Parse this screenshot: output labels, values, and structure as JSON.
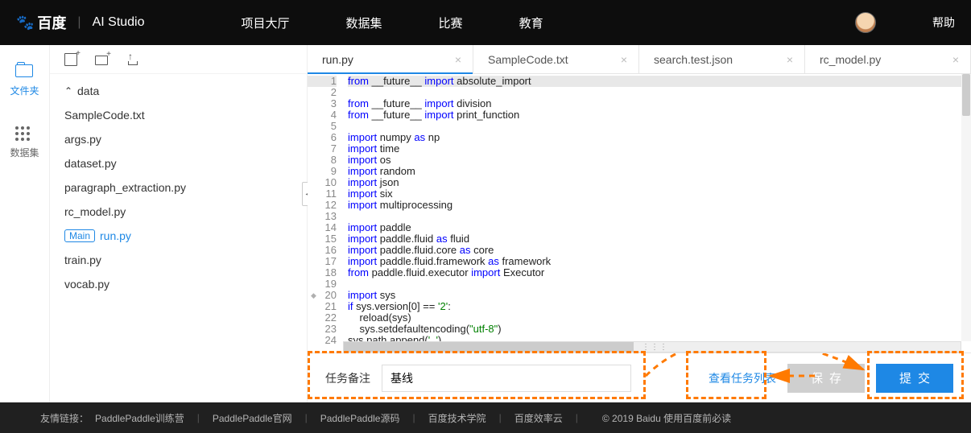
{
  "nav": {
    "logo_brand": "百度",
    "logo_product": "AI Studio",
    "items": [
      "项目大厅",
      "数据集",
      "比赛",
      "教育"
    ],
    "help": "帮助"
  },
  "rail": {
    "files_label": "文件夹",
    "dataset_label": "数据集"
  },
  "tree": {
    "folder": "data",
    "files": [
      "SampleCode.txt",
      "args.py",
      "dataset.py",
      "paragraph_extraction.py",
      "rc_model.py",
      "run.py",
      "train.py",
      "vocab.py"
    ],
    "main_badge": "Main",
    "active": "run.py"
  },
  "tabs": [
    {
      "name": "run.py",
      "active": true
    },
    {
      "name": "SampleCode.txt",
      "active": false
    },
    {
      "name": "search.test.json",
      "active": false
    },
    {
      "name": "rc_model.py",
      "active": false
    }
  ],
  "code": {
    "lines": [
      {
        "n": 1,
        "t": "from __future__ import absolute_import",
        "hl": true
      },
      {
        "n": 2,
        "t": "from __future__ import division"
      },
      {
        "n": 3,
        "t": "from __future__ import print_function"
      },
      {
        "n": 4,
        "t": ""
      },
      {
        "n": 5,
        "t": "import numpy as np"
      },
      {
        "n": 6,
        "t": "import time"
      },
      {
        "n": 7,
        "t": "import os"
      },
      {
        "n": 8,
        "t": "import random"
      },
      {
        "n": 9,
        "t": "import json"
      },
      {
        "n": 10,
        "t": "import six"
      },
      {
        "n": 11,
        "t": "import multiprocessing"
      },
      {
        "n": 12,
        "t": ""
      },
      {
        "n": 13,
        "t": "import paddle"
      },
      {
        "n": 14,
        "t": "import paddle.fluid as fluid"
      },
      {
        "n": 15,
        "t": "import paddle.fluid.core as core"
      },
      {
        "n": 16,
        "t": "import paddle.fluid.framework as framework"
      },
      {
        "n": 17,
        "t": "from paddle.fluid.executor import Executor"
      },
      {
        "n": 18,
        "t": ""
      },
      {
        "n": 19,
        "t": "import sys"
      },
      {
        "n": 20,
        "t": "if sys.version[0] == '2':",
        "break": true
      },
      {
        "n": 21,
        "t": "    reload(sys)"
      },
      {
        "n": 22,
        "t": "    sys.setdefaultencoding(\"utf-8\")"
      },
      {
        "n": 23,
        "t": "sys.path.append('..')"
      },
      {
        "n": 24,
        "t": ""
      }
    ]
  },
  "action": {
    "task_label": "任务备注",
    "task_value": "基线",
    "view_tasks": "查看任务列表",
    "save": "保存",
    "submit": "提交"
  },
  "footer": {
    "label": "友情链接：",
    "links": [
      "PaddlePaddle训练营",
      "PaddlePaddle官网",
      "PaddlePaddle源码",
      "百度技术学院",
      "百度效率云"
    ],
    "copy": "© 2019 Baidu 使用百度前必读"
  }
}
